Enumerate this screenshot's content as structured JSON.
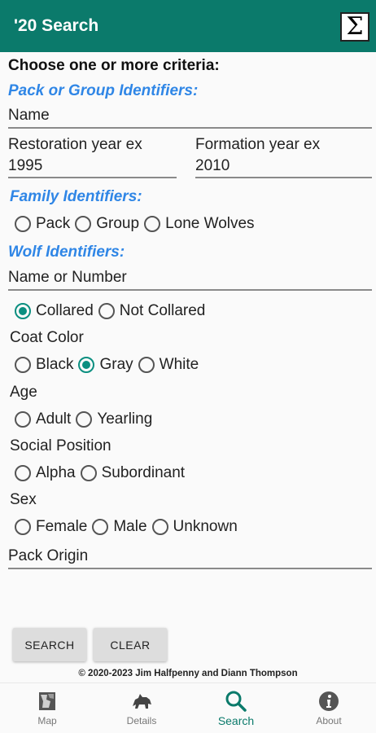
{
  "appbar": {
    "title": "'20 Search",
    "sigma_symbol": "Σ"
  },
  "form": {
    "prompt": "Choose one or more criteria:",
    "pack_section": "Pack or Group Identifiers:",
    "pack_name_placeholder": "Name",
    "restoration_year_placeholder": "Restoration year ex\n1995",
    "formation_year_placeholder": "Formation year ex\n2010",
    "family_section": "Family Identifiers:",
    "family_options": [
      "Pack",
      "Group",
      "Lone Wolves"
    ],
    "wolf_section": "Wolf Identifiers:",
    "wolf_name_placeholder": "Name or Number",
    "collar_options": [
      "Collared",
      "Not Collared"
    ],
    "collar_selected": "Collared",
    "coat_label": "Coat Color",
    "coat_options": [
      "Black",
      "Gray",
      "White"
    ],
    "coat_selected": "Gray",
    "age_label": "Age",
    "age_options": [
      "Adult",
      "Yearling"
    ],
    "social_label": "Social Position",
    "social_options": [
      "Alpha",
      "Subordinant"
    ],
    "sex_label": "Sex",
    "sex_options": [
      "Female",
      "Male",
      "Unknown"
    ],
    "pack_origin_placeholder": "Pack Origin"
  },
  "buttons": {
    "search": "SEARCH",
    "clear": "CLEAR"
  },
  "footer": {
    "copyright": "© 2020-2023 Jim Halfpenny and Diann Thompson"
  },
  "nav": {
    "items": [
      {
        "label": "Map",
        "icon": "map-icon"
      },
      {
        "label": "Details",
        "icon": "wolf-icon"
      },
      {
        "label": "Search",
        "icon": "search-icon"
      },
      {
        "label": "About",
        "icon": "info-icon"
      }
    ],
    "active": "Search"
  },
  "colors": {
    "appbar": "#0b7a6b",
    "section_heading": "#2f86e6",
    "radio_checked": "#0b8f80"
  }
}
